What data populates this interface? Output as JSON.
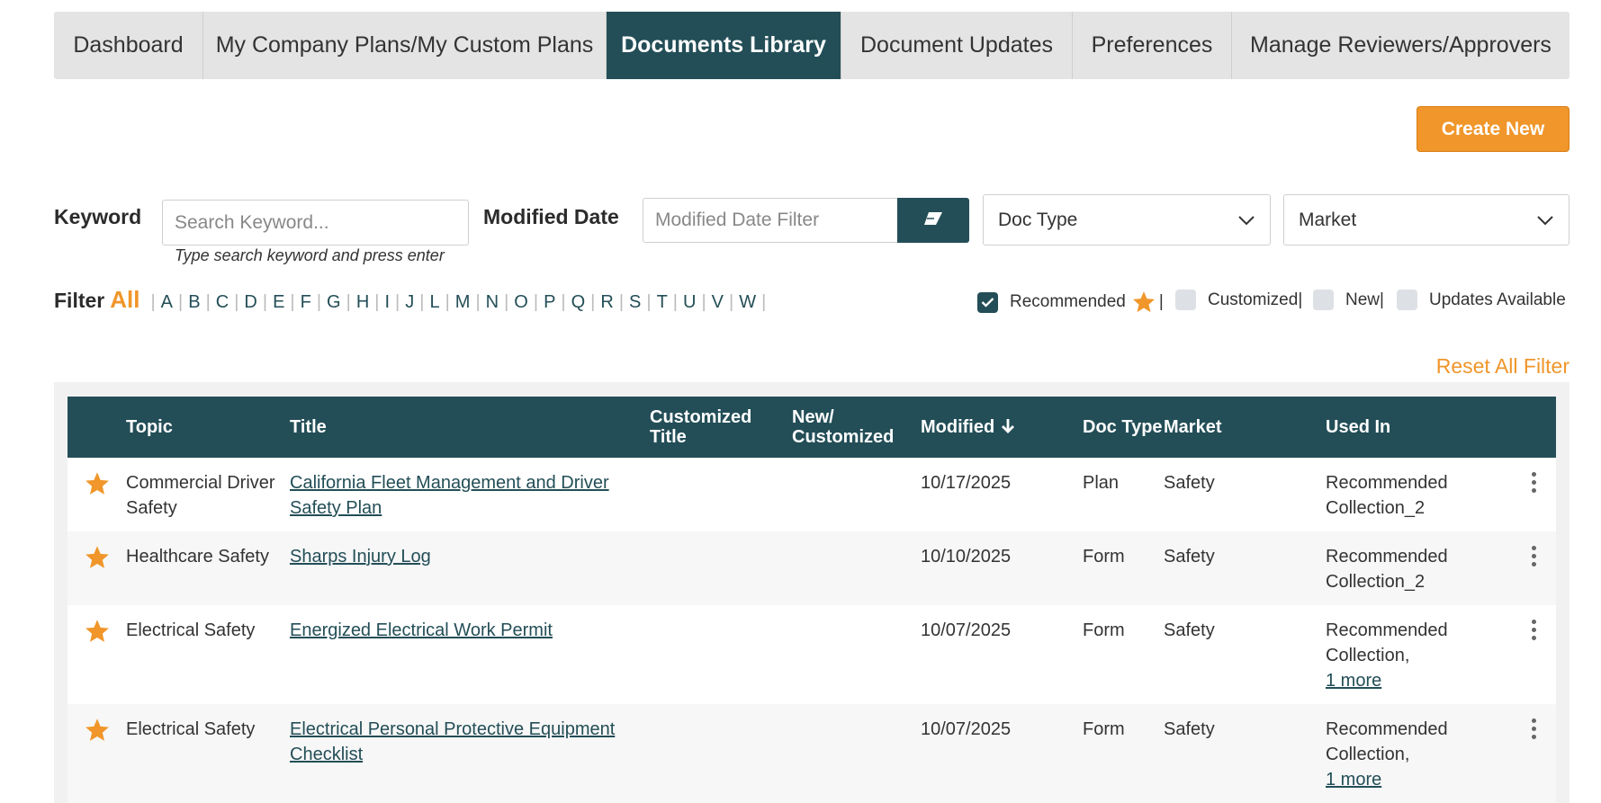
{
  "tabs": [
    {
      "label": "Dashboard",
      "active": false
    },
    {
      "label": "My Company Plans/My Custom Plans",
      "active": false
    },
    {
      "label": "Documents Library",
      "active": true
    },
    {
      "label": "Document Updates",
      "active": false
    },
    {
      "label": "Preferences",
      "active": false
    },
    {
      "label": "Manage Reviewers/Approvers",
      "active": false
    }
  ],
  "create_button": "Create New",
  "filters": {
    "keyword_label": "Keyword",
    "keyword_placeholder": "Search Keyword...",
    "keyword_hint": "Type search keyword and press enter",
    "modified_date_label": "Modified Date",
    "modified_date_placeholder": "Modified Date Filter",
    "doc_type": "Doc Type",
    "market": "Market"
  },
  "alphabet": {
    "label": "Filter",
    "all": "All",
    "letters": [
      "A",
      "B",
      "C",
      "D",
      "E",
      "F",
      "G",
      "H",
      "I",
      "J",
      "L",
      "M",
      "N",
      "O",
      "P",
      "Q",
      "R",
      "S",
      "T",
      "U",
      "V",
      "W"
    ]
  },
  "checkboxes": [
    {
      "label": "Recommended",
      "checked": true
    },
    {
      "label": "Customized",
      "checked": false
    },
    {
      "label": "New",
      "checked": false
    },
    {
      "label": "Updates Available",
      "checked": false
    }
  ],
  "reset_label": "Reset All Filter",
  "table": {
    "headers": {
      "topic": "Topic",
      "title": "Title",
      "customized_title": "Customized Title",
      "new_customized": "New/ Customized",
      "modified": "Modified",
      "doc_type": "Doc Type",
      "market": "Market",
      "used_in": "Used In"
    },
    "rows": [
      {
        "topic": "Commercial Driver Safety",
        "title": "California Fleet Management and Driver Safety Plan",
        "customized_title": "",
        "new_customized": "",
        "modified": "10/17/2025",
        "doc_type": "Plan",
        "market": "Safety",
        "used_in": "Recommended Collection_2",
        "more": ""
      },
      {
        "topic": "Healthcare Safety",
        "title": "Sharps Injury Log",
        "customized_title": "",
        "new_customized": "",
        "modified": "10/10/2025",
        "doc_type": "Form",
        "market": "Safety",
        "used_in": "Recommended Collection_2",
        "more": ""
      },
      {
        "topic": "Electrical Safety",
        "title": "Energized Electrical Work Permit",
        "customized_title": "",
        "new_customized": "",
        "modified": "10/07/2025",
        "doc_type": "Form",
        "market": "Safety",
        "used_in": "Recommended Collection,",
        "more": "1 more"
      },
      {
        "topic": "Electrical Safety",
        "title": "Electrical Personal Protective Equipment Checklist",
        "customized_title": "",
        "new_customized": "",
        "modified": "10/07/2025",
        "doc_type": "Form",
        "market": "Safety",
        "used_in": "Recommended Collection,",
        "more": "1 more"
      }
    ]
  },
  "colors": {
    "accent": "#f0962a",
    "primary": "#234e57"
  }
}
